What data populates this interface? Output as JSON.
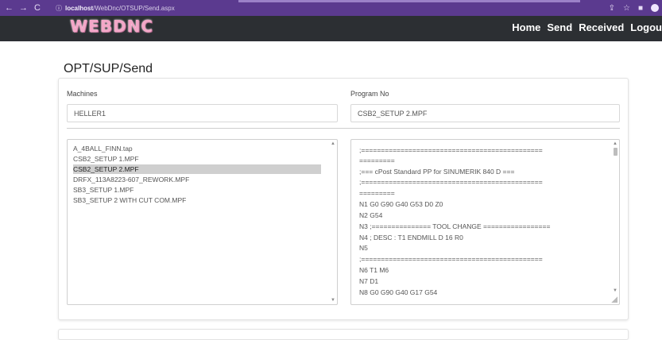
{
  "browser": {
    "nav_icons": [
      "back-icon",
      "forward-icon",
      "reload-icon"
    ],
    "info_icon": "info-icon",
    "url_host": "localhost",
    "url_path": "/WebDnc/OTSUP/Send.aspx",
    "right_icons": [
      "share-icon",
      "star-icon",
      "sidebar-icon"
    ]
  },
  "header": {
    "logo_text": "WEBDNC",
    "nav": {
      "home": "Home",
      "send": "Send",
      "received": "Received",
      "logout": "Logou"
    }
  },
  "page": {
    "title": "OPT/SUP/Send"
  },
  "form": {
    "machines_label": "Machines",
    "machines_value": "HELLER1",
    "program_label": "Program No",
    "program_value": "CSB2_SETUP 2.MPF"
  },
  "files": [
    "A_4BALL_FINN.tap",
    "CSB2_SETUP 1.MPF",
    "CSB2_SETUP 2.MPF",
    "DRFX_113A8223-607_REWORK.MPF",
    "SB3_SETUP 1.MPF",
    "SB3_SETUP 2 WITH CUT COM.MPF"
  ],
  "selected_file": "CSB2_SETUP 2.MPF",
  "program_text": [
    ";==============================================",
    "=========",
    ";===   cPost Standard PP for SINUMERIK 840 D      ===",
    ";==============================================",
    "=========",
    "N1 G0 G90 G40 G53 D0 Z0",
    "N2 G54",
    "N3 ;=============== TOOL CHANGE =================",
    "N4 ; DESC : T1 ENDMILL D 16 R0",
    "N5",
    ";==============================================",
    "N6 T1 M6",
    "N7 D1",
    "N8 G0 G90 G40 G17 G54"
  ]
}
